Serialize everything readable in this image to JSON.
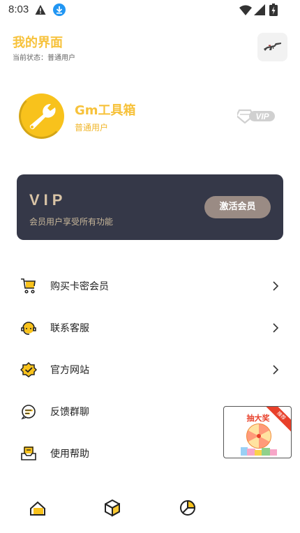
{
  "status_bar": {
    "time": "8:03"
  },
  "header": {
    "title": "我的界面",
    "subtitle": "当前状态：普通用户"
  },
  "profile": {
    "name": "Gm工具箱",
    "level": "普通用户",
    "badge": "VIP"
  },
  "vip_card": {
    "title": "VIP",
    "description": "会员用户享受所有功能",
    "button": "激活会员"
  },
  "menu": [
    {
      "label": "购买卡密会员",
      "icon": "cart-icon",
      "has_chevron": true
    },
    {
      "label": "联系客服",
      "icon": "customer-service-icon",
      "has_chevron": true
    },
    {
      "label": "官方网站",
      "icon": "website-badge-icon",
      "has_chevron": true
    },
    {
      "label": "反馈群聊",
      "icon": "chat-group-icon",
      "has_chevron": false
    },
    {
      "label": "使用帮助",
      "icon": "help-inbox-icon",
      "has_chevron": false
    }
  ],
  "lottery": {
    "title": "抽大奖",
    "ribbon": "推荐"
  },
  "bottom_nav": [
    {
      "icon": "home-icon"
    },
    {
      "icon": "cube-icon"
    },
    {
      "icon": "profile-pie-icon"
    }
  ],
  "colors": {
    "accent": "#f7c23b",
    "card": "#353848",
    "card_text": "#d9c4a6",
    "button": "#9a8b84"
  }
}
